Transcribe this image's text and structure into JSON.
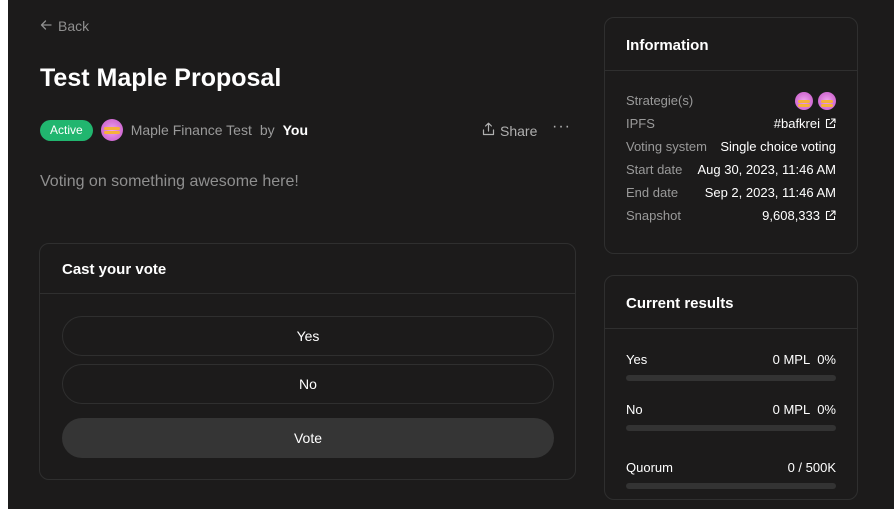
{
  "nav": {
    "back_label": "Back"
  },
  "proposal": {
    "title": "Test Maple Proposal",
    "status": "Active",
    "space_name": "Maple Finance Test",
    "by_label": "by",
    "author": "You",
    "share_label": "Share",
    "more_label": "···",
    "body": "Voting on something awesome here!"
  },
  "vote": {
    "heading": "Cast your vote",
    "choices": [
      "Yes",
      "No"
    ],
    "submit_label": "Vote"
  },
  "information": {
    "heading": "Information",
    "rows": [
      {
        "key": "Strategie(s)",
        "value": ""
      },
      {
        "key": "IPFS",
        "value": "#bafkrei"
      },
      {
        "key": "Voting system",
        "value": "Single choice voting"
      },
      {
        "key": "Start date",
        "value": "Aug 30, 2023, 11:46 AM"
      },
      {
        "key": "End date",
        "value": "Sep 2, 2023, 11:46 AM"
      },
      {
        "key": "Snapshot",
        "value": "9,608,333"
      }
    ]
  },
  "results": {
    "heading": "Current results",
    "items": [
      {
        "label": "Yes",
        "amount": "0 MPL",
        "percent": "0%",
        "fraction": 0
      },
      {
        "label": "No",
        "amount": "0 MPL",
        "percent": "0%",
        "fraction": 0
      }
    ],
    "quorum": {
      "label": "Quorum",
      "value": "0 / 500K",
      "fraction": 0
    }
  },
  "colors": {
    "background": "#1c1b1b",
    "border": "#2f2f2f",
    "active_badge": "#21b66f",
    "muted_text": "#8f8f8f"
  },
  "icons": {
    "back": "arrow-left-icon",
    "share": "share-icon",
    "external": "external-link-icon",
    "more": "more-dots-icon"
  }
}
